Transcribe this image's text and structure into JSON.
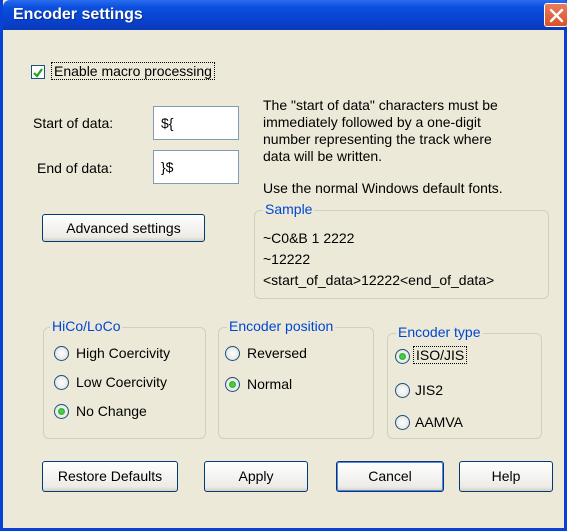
{
  "window": {
    "title": "Encoder settings"
  },
  "macro": {
    "label": "Enable macro processing",
    "checked": true
  },
  "fields": {
    "start_label": "Start of data:",
    "start_value": "${",
    "end_label": "End of data:",
    "end_value": "}$"
  },
  "info": {
    "line1": "The \"start of data\" characters must be",
    "line2": "immediately followed by a one-digit",
    "line3": "number representing the track where",
    "line4": "data will be written.",
    "fonts_note": "Use the normal Windows default fonts."
  },
  "sample": {
    "legend": "Sample",
    "line1": "~C0&B 1 2222",
    "line2": "~12222",
    "line3": "<start_of_data>12222<end_of_data>"
  },
  "buttons": {
    "advanced": "Advanced settings",
    "restore": "Restore Defaults",
    "apply": "Apply",
    "cancel": "Cancel",
    "help": "Help"
  },
  "hico": {
    "legend": "HiCo/LoCo",
    "options": [
      "High Coercivity",
      "Low Coercivity",
      "No Change"
    ],
    "selected": "No Change"
  },
  "position": {
    "legend": "Encoder position",
    "options": [
      "Reversed",
      "Normal"
    ],
    "selected": "Normal"
  },
  "type": {
    "legend": "Encoder type",
    "options": [
      "ISO/JIS",
      "JIS2",
      "AAMVA"
    ],
    "selected": "ISO/JIS"
  },
  "colors": {
    "titlebar": "#0A4FDD",
    "dialog_bg": "#ECE9D8",
    "legend_text": "#0046D5",
    "radio_selected": "#21A121",
    "close_button": "#D9532A"
  }
}
